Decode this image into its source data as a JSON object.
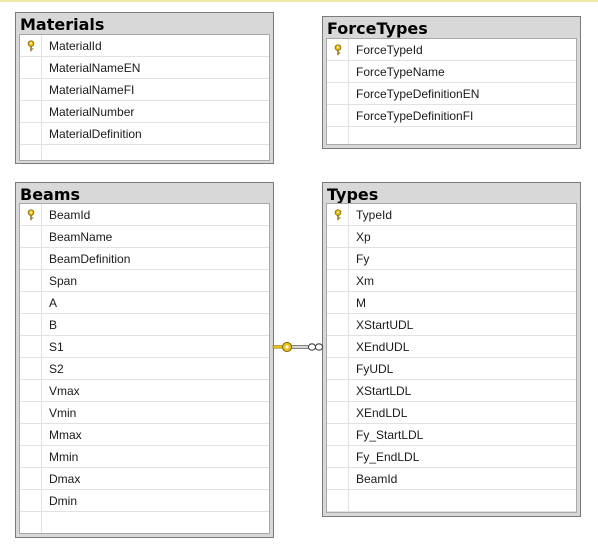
{
  "tables": {
    "materials": {
      "title": "Materials",
      "primary_key": "MaterialId",
      "columns": [
        "MaterialId",
        "MaterialNameEN",
        "MaterialNameFI",
        "MaterialNumber",
        "MaterialDefinition"
      ]
    },
    "forcetypes": {
      "title": "ForceTypes",
      "primary_key": "ForceTypeId",
      "columns": [
        "ForceTypeId",
        "ForceTypeName",
        "ForceTypeDefinitionEN",
        "ForceTypeDefinitionFI"
      ]
    },
    "beams": {
      "title": "Beams",
      "primary_key": "BeamId",
      "columns": [
        "BeamId",
        "BeamName",
        "BeamDefinition",
        "Span",
        "A",
        "B",
        "S1",
        "S2",
        "Vmax",
        "Vmin",
        "Mmax",
        "Mmin",
        "Dmax",
        "Dmin"
      ]
    },
    "types": {
      "title": "Types",
      "primary_key": "TypeId",
      "columns": [
        "TypeId",
        "Xp",
        "Fy",
        "Xm",
        "M",
        "XStartUDL",
        "XEndUDL",
        "FyUDL",
        "XStartLDL",
        "XEndLDL",
        "Fy_StartLDL",
        "Fy_EndLDL",
        "BeamId"
      ]
    }
  },
  "relationship": {
    "from_table": "Beams",
    "to_table": "Types",
    "from_end": "one (key)",
    "to_end": "many (infinity)"
  },
  "colors": {
    "table_frame": "#d8d8d8",
    "table_border": "#7a7a7a",
    "key_gold": "#e6c21a",
    "top_accent": "#f3e9a6"
  },
  "icons": {
    "primary_key": "key-icon",
    "relationship_one": "key-icon",
    "relationship_many": "infinity-icon"
  }
}
